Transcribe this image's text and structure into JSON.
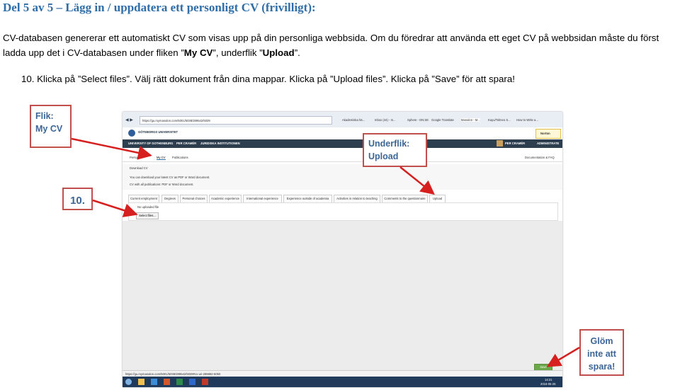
{
  "heading": "Del 5 av 5 – Lägg in / uppdatera ett personligt CV (frivilligt):",
  "intro": {
    "part1": "CV-databasen genererar ett automatiskt CV som visas upp på din personliga webbsida. Om du föredrar att använda ett eget CV på webbsidan måste du först ladda upp det i CV-databasen under fliken ”",
    "tab_name": "My CV",
    "part2": "”, underflik ”",
    "subtab_name": "Upload",
    "part3": "”."
  },
  "step_10": "10.  Klicka på ”Select files”. Välj rätt dokument från dina mappar. Klicka på ”Upload files”. Klicka på ”Save” för att spara!",
  "callouts": {
    "flik": [
      "Flik:",
      "My CV"
    ],
    "underflik": [
      "Underflik:",
      "Upload"
    ],
    "number": "10.",
    "glom": [
      "Glöm",
      "inte att",
      "spara!"
    ]
  },
  "screenshot": {
    "url": "https://gu.mymanalon.com/5001/5038/289542/5039",
    "browser_tabs": [
      "Akademiska hä...",
      "Inbox (44) - m...",
      "Sphere - DN:SE",
      "Google Translate",
      "Manalon - M...",
      "Kayu/Tolmeo S...",
      "How to Write a..."
    ],
    "university_name": "GÖTEBORGS UNIVERSITET",
    "nav_left": [
      "UNIVERSITY OF GOTHENBURG",
      "PER CRAMÉR",
      "JURIDISKA INSTITUTIONEN"
    ],
    "user_name": "PER CRAMÉR",
    "admin_label": "ADMINISTRATE",
    "subtabs": [
      "Personal",
      "My CV",
      "Publications"
    ],
    "doc_link": "Documentation & FAQ",
    "download_title": "Download CV",
    "download_line1": "You can download your latest CV as PDF or Word document.",
    "download_line2": "CV with all publications: PDF or Word document.",
    "cv_tabs": [
      "Current employment",
      "Degrees",
      "Personal choices",
      "Academic experience",
      "International experience",
      "Experience outside of academia",
      "Activities in relation to teaching",
      "Comments to the questionnaire",
      "Upload"
    ],
    "no_file": "No uploaded file",
    "select_files": "Select files...",
    "save": "Save",
    "status_url": "https://gu.mymanalon.com/5001/5038/289542/5039#cv-uri-289882-5050",
    "norton": "Norton",
    "clock_time": "14:21",
    "clock_date": "2016-05-25"
  },
  "colors": {
    "heading": "#2f6ea8",
    "callout_border": "#c0504d",
    "callout_text": "#3d6696",
    "nav_bar": "#2d3e4f",
    "taskbar": "#1f3a5a",
    "save_green": "#6ca84a"
  }
}
